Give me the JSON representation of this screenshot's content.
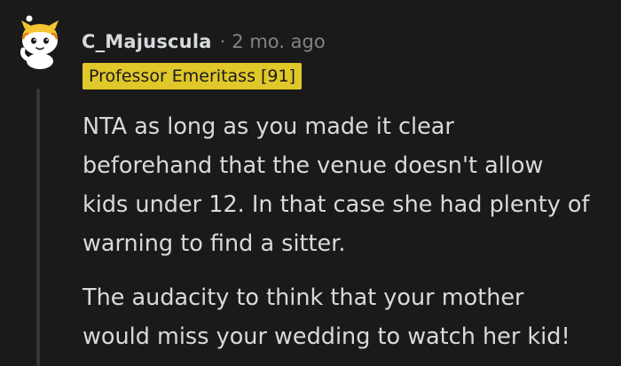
{
  "comment": {
    "username": "C_Majuscula",
    "separator": "·",
    "timestamp": "2 mo. ago",
    "flair": "Professor Emeritass [91]",
    "paragraphs": [
      {
        "lines": [
          "NTA as long as you made it clear",
          "beforehand that the venue doesn't allow",
          "kids under 12. In that case she had plenty of",
          "warning to find a sitter."
        ]
      },
      {
        "lines": [
          "The audacity to think that your mother",
          "would miss your wedding to watch her kid!"
        ]
      }
    ]
  },
  "colors": {
    "background": "#1a1a1b",
    "text": "#d7dadc",
    "muted": "#818384",
    "flair_bg": "#e0c72a",
    "thread_line": "#343536"
  },
  "icons": {
    "avatar": "snoo-avatar-icon"
  }
}
